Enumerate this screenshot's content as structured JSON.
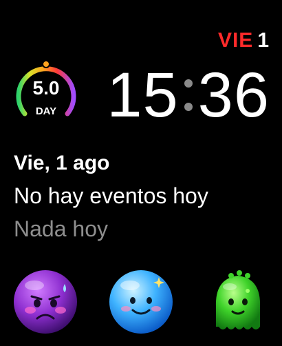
{
  "date_corner": {
    "day": "VIE",
    "number": "1"
  },
  "uv_complication": {
    "value": "5.0",
    "label": "DAY"
  },
  "clock": {
    "hours": "15",
    "minutes": "36"
  },
  "events": {
    "date": "Vie, 1 ago",
    "primary": "No hay eventos hoy",
    "secondary": "Nada hoy"
  },
  "emojis": [
    {
      "name": "sad-purple-blob-icon",
      "color": "#8e2fd0"
    },
    {
      "name": "happy-blue-blob-icon",
      "color": "#3fb3ff"
    },
    {
      "name": "green-monster-icon",
      "color": "#3fd32a"
    }
  ],
  "colors": {
    "background": "#000000",
    "accent_red": "#ff2a2a",
    "text": "#ffffff",
    "muted": "#8e8e8e"
  }
}
